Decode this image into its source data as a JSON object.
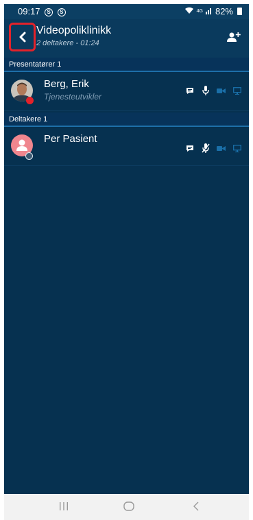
{
  "status_bar": {
    "time": "09:17",
    "s1": "S",
    "s2": "S",
    "network": "4G",
    "battery": "82%"
  },
  "header": {
    "title": "Videopoliklinikk",
    "subtitle": "2 deltakere - 01:24"
  },
  "sections": {
    "presenters": {
      "label": "Presentatører 1",
      "participant": {
        "name": "Berg, Erik",
        "role": "Tjenesteutvikler"
      }
    },
    "participants": {
      "label": "Deltakere 1",
      "participant": {
        "name": "Per Pasient",
        "role": ""
      }
    }
  },
  "colors": {
    "background": "#063150",
    "highlight_border": "#e4222a",
    "section_divider": "#1e6fa8",
    "disabled_icon": "#1a6fa8",
    "patient_avatar": "#f0868e"
  }
}
